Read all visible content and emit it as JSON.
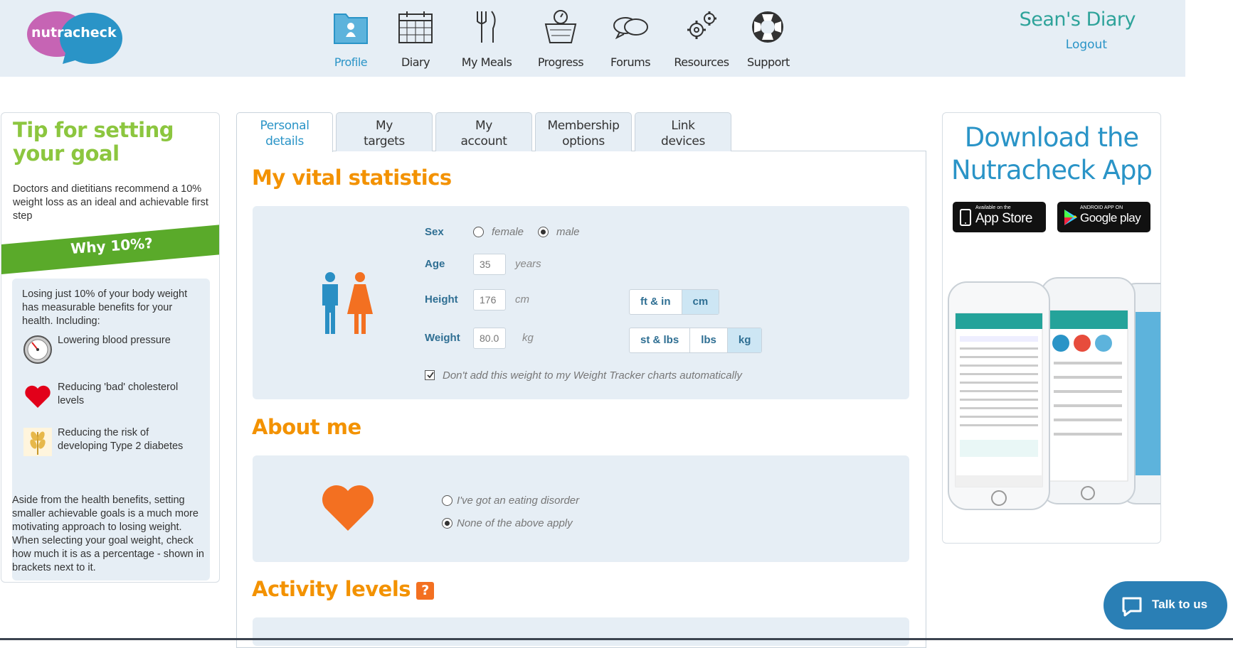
{
  "user": {
    "diary_name": "Sean's Diary",
    "logout": "Logout"
  },
  "logo": {
    "left_word": "nutra",
    "right_word": "check"
  },
  "nav": [
    {
      "label": "Profile",
      "icon": "profile-icon"
    },
    {
      "label": "Diary",
      "icon": "calendar-icon"
    },
    {
      "label": "My Meals",
      "icon": "cutlery-icon"
    },
    {
      "label": "Progress",
      "icon": "scale-icon"
    },
    {
      "label": "Forums",
      "icon": "chat-bubbles-icon"
    },
    {
      "label": "Resources",
      "icon": "gears-icon"
    },
    {
      "label": "Support",
      "icon": "lifebuoy-icon"
    }
  ],
  "tip": {
    "title": "Tip for setting your goal",
    "intro": "Doctors and dietitians recommend a 10% weight loss as an ideal and achievable first step",
    "why": "Why 10%?",
    "benefits_intro": "Losing just 10% of your body weight has measurable benefits for your health. Including:",
    "benefits": [
      {
        "text": "Lowering blood pressure",
        "icon": "blood-pressure-gauge-icon"
      },
      {
        "text": "Reducing 'bad' cholesterol levels",
        "icon": "heart-icon"
      },
      {
        "text": "Reducing the risk of developing Type 2 diabetes",
        "icon": "wheat-icon"
      }
    ],
    "outro": "Aside from the health benefits, setting smaller achievable goals is a much more motivating approach to losing weight.",
    "outro2": "When selecting your goal weight, check how much it is as a percentage - shown in brackets next to it."
  },
  "tabs": [
    {
      "label": "Personal details",
      "active": true
    },
    {
      "label": "My targets"
    },
    {
      "label": "My account"
    },
    {
      "label": "Membership options"
    },
    {
      "label": "Link devices"
    }
  ],
  "vitals": {
    "title": "My vital statistics",
    "sex_label": "Sex",
    "sex_options": [
      "female",
      "male"
    ],
    "sex_selected": "male",
    "age_label": "Age",
    "age_value": "35",
    "age_unit": "years",
    "height_label": "Height",
    "height_value": "176",
    "height_unit": "cm",
    "height_units": [
      "ft & in",
      "cm"
    ],
    "height_selected": "cm",
    "weight_label": "Weight",
    "weight_value": "80.0",
    "weight_unit": "kg",
    "weight_units": [
      "st & lbs",
      "lbs",
      "kg"
    ],
    "weight_selected": "kg",
    "tracker_checkbox": "Don't add this weight to my Weight Tracker charts automatically",
    "tracker_checked": true
  },
  "about": {
    "title": "About me",
    "options": [
      "I've got an eating disorder",
      "None of the above apply"
    ],
    "selected": "None of the above apply"
  },
  "activity": {
    "title": "Activity levels",
    "help": "?"
  },
  "app": {
    "title_line1": "Download the",
    "title_line2": "Nutracheck App",
    "appstore_small": "Available on the",
    "appstore_big": "App Store",
    "play_small": "ANDROID APP ON",
    "play_big": "Google play"
  },
  "chat": {
    "label": "Talk to us"
  },
  "colors": {
    "brand_blue": "#2a94c7",
    "brand_orange": "#f39200",
    "brand_green": "#8cc63f",
    "panel_bg": "#e6eef5"
  }
}
